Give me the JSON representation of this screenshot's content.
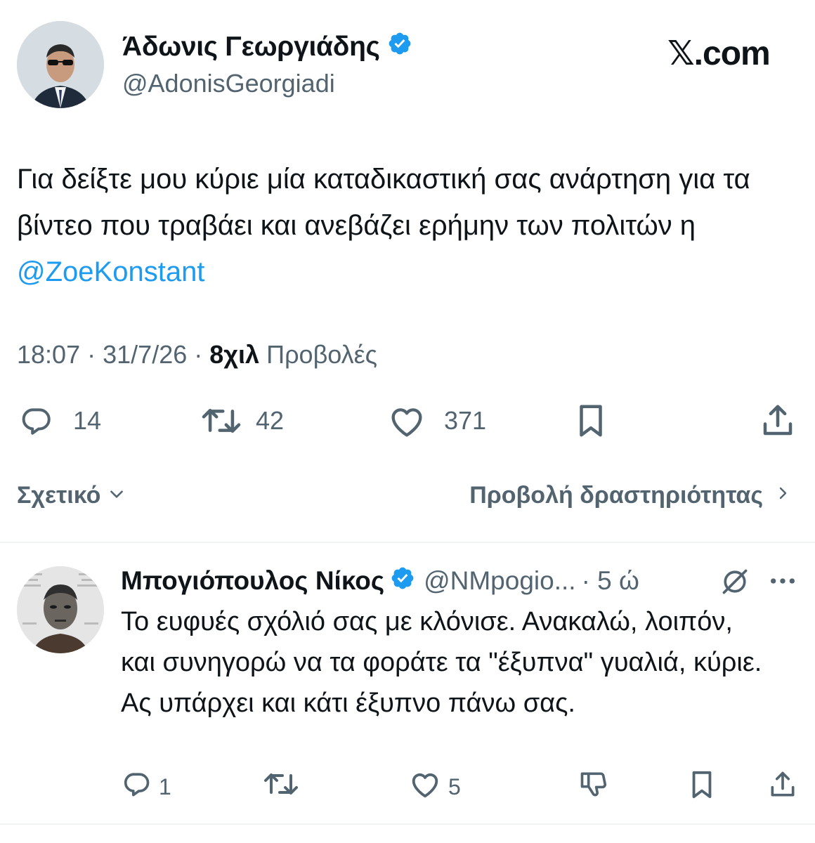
{
  "author": {
    "name": "Άδωνις Γεωργιάδης",
    "handle": "@AdonisGeorgiadi"
  },
  "brand": {
    "logo_text": "𝕏.com"
  },
  "tweet": {
    "text": "Για δείξτε μου κύριε μία καταδικαστική σας ανάρτηση για τα βίντεο που τραβάει και ανεβάζει ερήμην των πολιτών η ",
    "mention": "@ZoeKonstant",
    "time": "18:07",
    "date": "31/7/26",
    "views_count": "8χιλ",
    "views_label": "Προβολές",
    "separator": "·"
  },
  "actions": {
    "replies": "14",
    "reposts": "42",
    "likes": "371"
  },
  "related_label": "Σχετικό",
  "activity_label": "Προβολή δραστηριότητας",
  "reply": {
    "name": "Μπογιόπουλος Νίκος",
    "handle": "@NMpogio...",
    "time": "· 5 ώ",
    "text": "Το ευφυές σχόλιό σας με κλόνισε. Ανακαλώ, λοιπόν, και συνηγορώ να τα φοράτε τα \"έξυπνα\" γυαλιά, κύριε. Ας υπάρχει και κάτι έξυπνο πάνω σας.",
    "replies": "1",
    "likes": "5"
  },
  "colors": {
    "accent": "#1d9bf0",
    "secondary_text": "#536471",
    "primary_text": "#0f1419"
  }
}
